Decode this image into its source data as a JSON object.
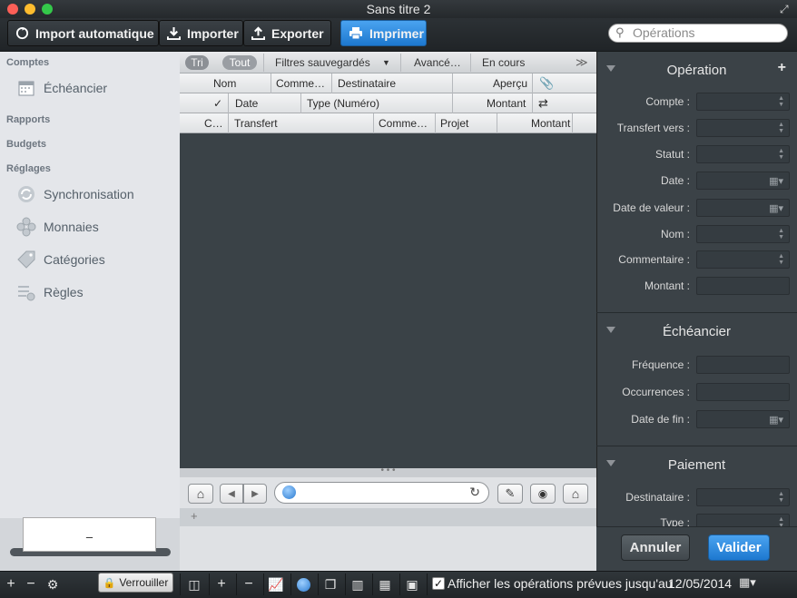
{
  "window": {
    "title": "Sans titre 2"
  },
  "toolbar": {
    "import_auto": "Import automatique",
    "import": "Importer",
    "export": "Exporter",
    "print": "Imprimer",
    "search_placeholder": "Opérations"
  },
  "sidebar": {
    "sections": {
      "accounts": "Comptes",
      "reports": "Rapports",
      "budgets": "Budgets",
      "settings": "Réglages"
    },
    "items": [
      {
        "label": "Échéancier",
        "icon": "calendar-icon"
      },
      {
        "label": "Synchronisation",
        "icon": "sync-icon"
      },
      {
        "label": "Monnaies",
        "icon": "coins-icon"
      },
      {
        "label": "Catégories",
        "icon": "tag-icon"
      },
      {
        "label": "Règles",
        "icon": "rules-icon"
      }
    ],
    "ticker_value": "–"
  },
  "filterbar": {
    "sort": "Tri",
    "all": "Tout",
    "saved_filters": "Filtres sauvegardés",
    "advanced": "Avancé…",
    "in_progress": "En cours"
  },
  "columns": {
    "row1": [
      "Nom",
      "Comme…",
      "Destinataire",
      "Aperçu"
    ],
    "row2": [
      "✓",
      "Date",
      "Type (Numéro)",
      "Montant"
    ],
    "row3": [
      "C…",
      "Transfert",
      "Comme…",
      "Projet",
      "Montant"
    ]
  },
  "operation": {
    "title": "Opération",
    "fields": [
      "Compte :",
      "Transfert vers :",
      "Statut :",
      "Date :",
      "Date de valeur :",
      "Nom :",
      "Commentaire :",
      "Montant :"
    ]
  },
  "schedule": {
    "title": "Échéancier",
    "fields": [
      "Fréquence :",
      "Occurrences :",
      "Date de fin :"
    ]
  },
  "payment": {
    "title": "Paiement",
    "fields": [
      "Destinataire :",
      "Type :"
    ]
  },
  "actions": {
    "cancel": "Annuler",
    "validate": "Valider"
  },
  "bottombar": {
    "lock": "Verrouiller",
    "show_planned": "Afficher les opérations prévues jusqu'au",
    "date": "12/05/2014"
  },
  "colors": {
    "accent": "#2a8ae4",
    "panel": "#3b4247",
    "sidebar": "#e4e6ea"
  }
}
